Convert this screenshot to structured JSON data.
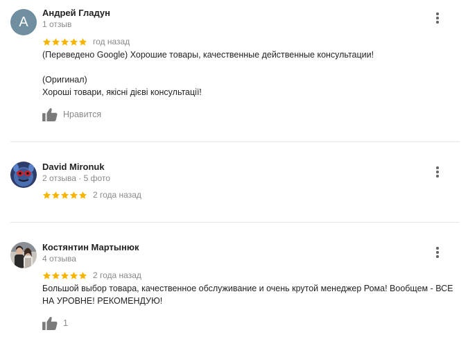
{
  "colors": {
    "star": "#f4b400",
    "muted": "#888888",
    "avatar_letter_bg": "#6f8fa0"
  },
  "icons": {
    "rating": "star-icon",
    "like": "thumbs-up-icon",
    "menu": "more-vert-icon"
  },
  "reviews": [
    {
      "avatar_letter": "А",
      "author": "Андрей Гладун",
      "meta": "1 отзыв",
      "rating": 5,
      "date": "год назад",
      "text_translated": "(Переведено Google) Хорошие товары, качественные действенные консультации!",
      "original_label": "(Оригинал)",
      "text_original": "Хороші товари, якісні дієві консультації!",
      "like_label": "Нравится"
    },
    {
      "author": "David Mironuk",
      "meta": "2 отзыва · 5 фото",
      "rating": 5,
      "date": "2 года назад"
    },
    {
      "author": "Костянтин Мартынюк",
      "meta": "4 отзыва",
      "rating": 5,
      "date": "2 года назад",
      "text": "Большой выбор товара, качественное обслуживание и очень крутой менеджер Рома! Вообщем - ВСЕ НА УРОВНЕ! РЕКОМЕНДУЮ!",
      "like_label": "1"
    }
  ]
}
